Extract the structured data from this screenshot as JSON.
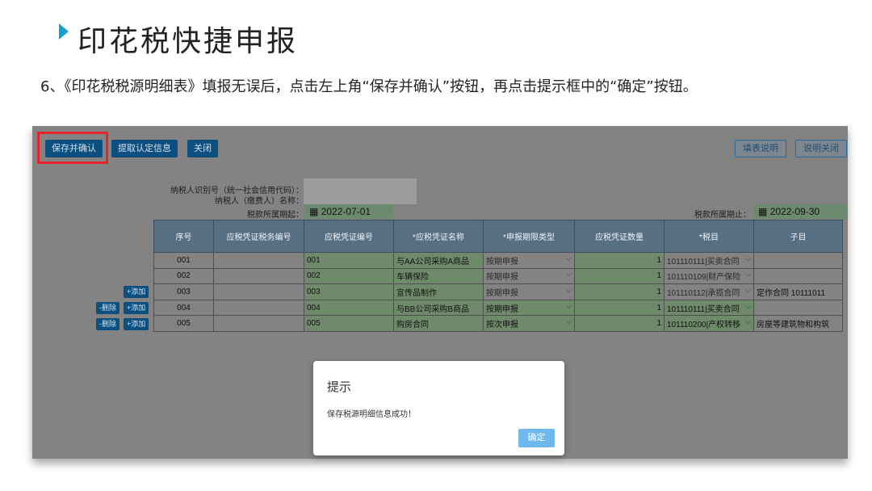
{
  "slide": {
    "title": "印花税快捷申报",
    "instruction": "6、《印花税税源明细表》填报无误后，点击左上角“保存并确认”按钮，再点击提示框中的“确定”按钮。"
  },
  "toolbar": {
    "save_confirm": "保存并确认",
    "fetch_info": "提取认定信息",
    "close": "关闭",
    "fill_guide": "填表说明",
    "guide_close": "说明关闭"
  },
  "form": {
    "taxpayer_id_label": "纳税人识别号（统一社会信用代码）：",
    "taxpayer_name_label": "纳税人（缴费人）名称：",
    "period_start_label": "税款所属期起：",
    "period_start": "2022-07-01",
    "period_end_label": "税款所属期止：",
    "period_end": "2022-09-30",
    "calendar_icon": "calendar-icon"
  },
  "table": {
    "headers": [
      "序号",
      "应税凭证税务编号",
      "应税凭证编号",
      "*应税凭证名称",
      "*申报期限类型",
      "应税凭证数量",
      "*税目",
      "子目"
    ],
    "rows": [
      {
        "seq": "001",
        "tax_no": "",
        "cert_no": "001",
        "name": "与AA公司采购A商品",
        "period_type": "按期申报",
        "qty": "1",
        "item": "101110111|买卖合同",
        "sub": ""
      },
      {
        "seq": "002",
        "tax_no": "",
        "cert_no": "002",
        "name": "车辆保险",
        "period_type": "按期申报",
        "qty": "1",
        "item": "101110109|财产保险",
        "sub": ""
      },
      {
        "seq": "003",
        "tax_no": "",
        "cert_no": "003",
        "name": "宣传品制作",
        "period_type": "按期申报",
        "qty": "1",
        "item": "101110112|承揽合同",
        "sub": "定作合同 10111011"
      },
      {
        "seq": "004",
        "tax_no": "",
        "cert_no": "004",
        "name": "与BB公司采购B商品",
        "period_type": "按期申报",
        "qty": "1",
        "item": "101110111|买卖合同",
        "sub": ""
      },
      {
        "seq": "005",
        "tax_no": "",
        "cert_no": "005",
        "name": "购房合同",
        "period_type": "按次申报",
        "qty": "1",
        "item": "101110200|产权转移",
        "sub": "房屋等建筑物和构筑"
      }
    ],
    "add_label": "+添加",
    "delete_label": "-删除"
  },
  "dialog": {
    "title": "提示",
    "message": "保存税源明细信息成功！",
    "ok": "确定"
  },
  "colors": {
    "title_marker": "#1aa0c8",
    "highlight": "#e8232a",
    "button": "#0d4f7f",
    "header": "#566f83",
    "green_cell": "#6f8a6a",
    "ok_button": "#6fb8ee"
  }
}
